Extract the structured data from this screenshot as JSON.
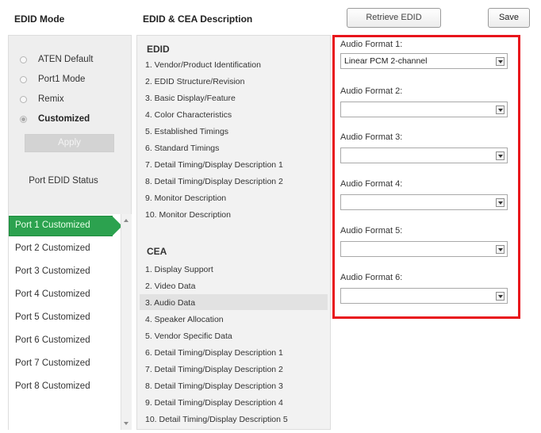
{
  "header": {
    "edid_mode_title": "EDID Mode",
    "description_title": "EDID & CEA Description",
    "retrieve_label": "Retrieve EDID",
    "save_label": "Save"
  },
  "edid_mode": {
    "options": [
      {
        "label": "ATEN Default",
        "selected": false
      },
      {
        "label": "Port1 Mode",
        "selected": false
      },
      {
        "label": "Remix",
        "selected": false
      },
      {
        "label": "Customized",
        "selected": true
      }
    ],
    "apply_label": "Apply",
    "port_status_label": "Port EDID Status"
  },
  "ports": [
    "Port 1  Customized",
    "Port 2  Customized",
    "Port 3  Customized",
    "Port 4  Customized",
    "Port 5  Customized",
    "Port 6  Customized",
    "Port 7  Customized",
    "Port 8  Customized"
  ],
  "description": {
    "edid_title": "EDID",
    "edid_items": [
      "1.  Vendor/Product Identification",
      "2.  EDID Structure/Revision",
      "3.  Basic Display/Feature",
      "4.  Color Characteristics",
      "5.  Established Timings",
      "6.  Standard Timings",
      "7.  Detail Timing/Display Description 1",
      "8.  Detail Timing/Display Description 2",
      "9.  Monitor Description",
      "10.  Monitor Description"
    ],
    "cea_title": "CEA",
    "cea_items": [
      "1.  Display Support",
      "2.  Video Data",
      "3.  Audio Data",
      "4.  Speaker Allocation",
      "5.  Vendor Specific Data",
      "6.  Detail Timing/Display Description 1",
      "7.  Detail Timing/Display Description 2",
      "8.  Detail Timing/Display Description 3",
      "9.  Detail Timing/Display Description 4",
      "10.  Detail Timing/Display Description 5"
    ]
  },
  "audio_formats": [
    {
      "label": "Audio Format 1:",
      "value": "Linear PCM 2-channel"
    },
    {
      "label": "Audio Format 2:",
      "value": ""
    },
    {
      "label": "Audio Format 3:",
      "value": ""
    },
    {
      "label": "Audio Format 4:",
      "value": ""
    },
    {
      "label": "Audio Format 5:",
      "value": ""
    },
    {
      "label": "Audio Format 6:",
      "value": ""
    }
  ],
  "colors": {
    "active_port": "#2ca24f",
    "highlight_border": "#e8141b"
  },
  "icons": [
    "radio-icon",
    "dropdown-arrow-icon",
    "scroll-up-icon",
    "scroll-down-icon",
    "arrow-pointer-icon"
  ]
}
